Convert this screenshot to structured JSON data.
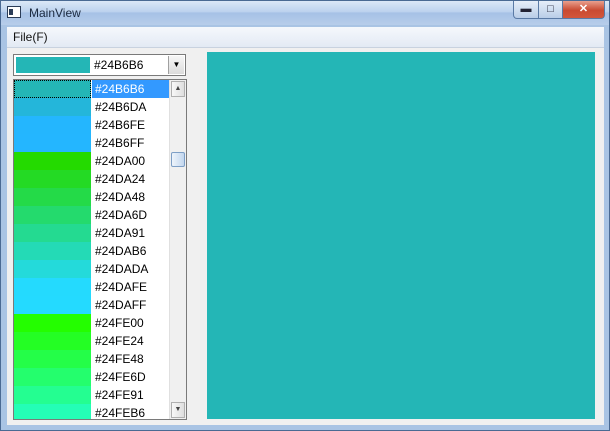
{
  "window": {
    "title": "MainView"
  },
  "menu": {
    "file_label": "File(F)"
  },
  "combo": {
    "selected_text": "#24B6B6",
    "selected_color": "#24B6B6"
  },
  "list": {
    "selected_index": 0,
    "items": [
      {
        "label": "#24B6B6",
        "color": "#24B6B6"
      },
      {
        "label": "#24B6DA",
        "color": "#24B6DA"
      },
      {
        "label": "#24B6FE",
        "color": "#24B6FE"
      },
      {
        "label": "#24B6FF",
        "color": "#24B6FF"
      },
      {
        "label": "#24DA00",
        "color": "#24DA00"
      },
      {
        "label": "#24DA24",
        "color": "#24DA24"
      },
      {
        "label": "#24DA48",
        "color": "#24DA48"
      },
      {
        "label": "#24DA6D",
        "color": "#24DA6D"
      },
      {
        "label": "#24DA91",
        "color": "#24DA91"
      },
      {
        "label": "#24DAB6",
        "color": "#24DAB6"
      },
      {
        "label": "#24DADA",
        "color": "#24DADA"
      },
      {
        "label": "#24DAFE",
        "color": "#24DAFE"
      },
      {
        "label": "#24DAFF",
        "color": "#24DAFF"
      },
      {
        "label": "#24FE00",
        "color": "#24FE00"
      },
      {
        "label": "#24FE24",
        "color": "#24FE24"
      },
      {
        "label": "#24FE48",
        "color": "#24FE48"
      },
      {
        "label": "#24FE6D",
        "color": "#24FE6D"
      },
      {
        "label": "#24FE91",
        "color": "#24FE91"
      },
      {
        "label": "#24FEB6",
        "color": "#24FEB6"
      }
    ]
  },
  "preview": {
    "color": "#24B6B6"
  },
  "icons": {
    "minimize": "minimize-icon",
    "maximize": "maximize-icon",
    "close": "close-icon",
    "dropdown_arrow": "chevron-down-icon"
  }
}
